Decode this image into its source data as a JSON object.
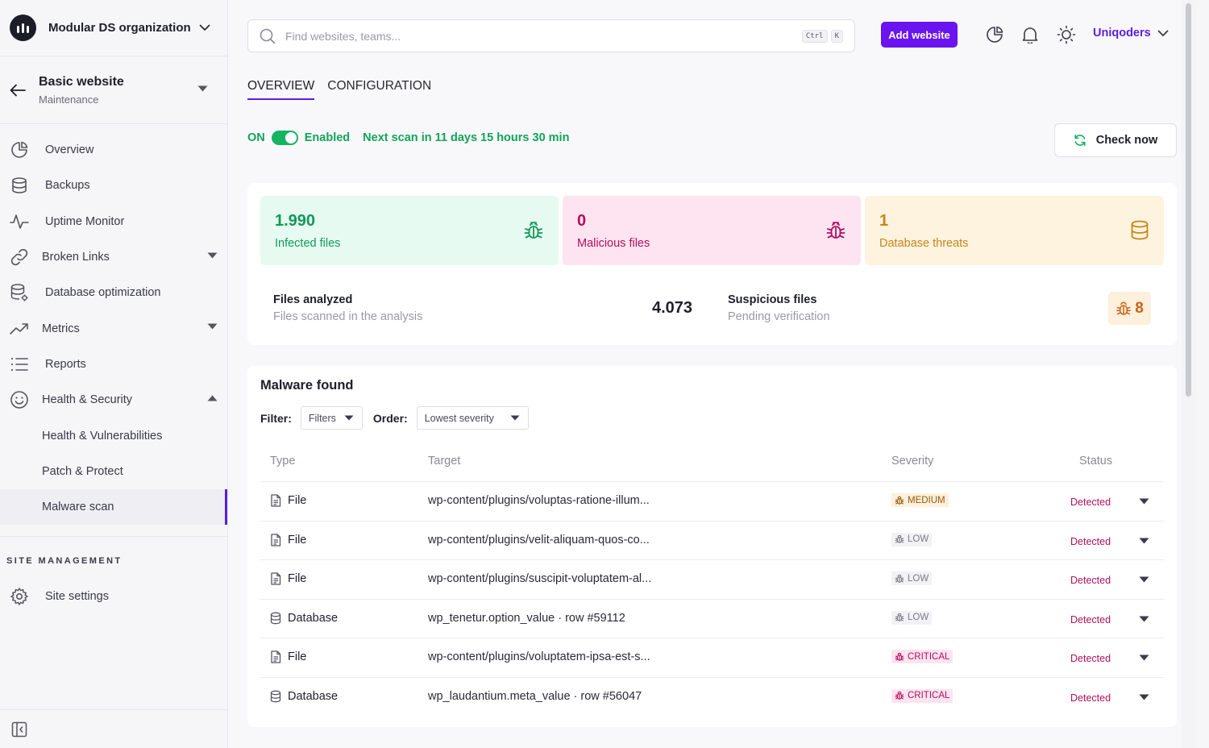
{
  "org": {
    "name": "Modular DS organization"
  },
  "site": {
    "title": "Basic website",
    "subtitle": "Maintenance"
  },
  "nav": {
    "overview": "Overview",
    "backups": "Backups",
    "uptime": "Uptime Monitor",
    "broken_links": "Broken Links",
    "db_opt": "Database optimization",
    "metrics": "Metrics",
    "reports": "Reports",
    "health_security": "Health & Security",
    "health_vuln": "Health & Vulnerabilities",
    "patch": "Patch & Protect",
    "malware": "Malware scan"
  },
  "site_management": {
    "title": "SITE MANAGEMENT",
    "settings": "Site settings"
  },
  "search": {
    "placeholder": "Find websites, teams...",
    "kbd1": "Ctrl",
    "kbd2": "K"
  },
  "header": {
    "add_website": "Add website",
    "user": "Uniqoders"
  },
  "tabs": {
    "overview": "OVERVIEW",
    "configuration": "CONFIGURATION"
  },
  "status": {
    "on": "ON",
    "enabled": "Enabled",
    "next_scan": "Next scan in 11 days 15 hours 30 min",
    "check_now": "Check now"
  },
  "stats": {
    "infected": {
      "value": "1.990",
      "label": "Infected files"
    },
    "malicious": {
      "value": "0",
      "label": "Malicious files"
    },
    "db_threats": {
      "value": "1",
      "label": "Database threats"
    },
    "analyzed": {
      "title": "Files analyzed",
      "subtitle": "Files scanned in the analysis",
      "value": "4.073"
    },
    "suspicious": {
      "title": "Suspicious files",
      "subtitle": "Pending verification",
      "value": "8"
    }
  },
  "malware": {
    "title": "Malware found",
    "filter_label": "Filter:",
    "filter_value": "Filters",
    "order_label": "Order:",
    "order_value": "Lowest severity",
    "columns": {
      "type": "Type",
      "target": "Target",
      "severity": "Severity",
      "status": "Status"
    },
    "rows": [
      {
        "type": "File",
        "target": "wp-content/plugins/voluptas-ratione-illum...",
        "severity": "MEDIUM",
        "status": "Detected"
      },
      {
        "type": "File",
        "target": "wp-content/plugins/velit-aliquam-quos-co...",
        "severity": "LOW",
        "status": "Detected"
      },
      {
        "type": "File",
        "target": "wp-content/plugins/suscipit-voluptatem-al...",
        "severity": "LOW",
        "status": "Detected"
      },
      {
        "type": "Database",
        "target": "wp_tenetur.option_value · row #59112",
        "severity": "LOW",
        "status": "Detected"
      },
      {
        "type": "File",
        "target": "wp-content/plugins/voluptatem-ipsa-est-s...",
        "severity": "CRITICAL",
        "status": "Detected"
      },
      {
        "type": "Database",
        "target": "wp_laudantium.meta_value · row #56047",
        "severity": "CRITICAL",
        "status": "Detected"
      }
    ]
  },
  "colors": {
    "accent": "#6a14f0",
    "green": "#12a35a",
    "pink": "#b0105e",
    "amber": "#c7861a"
  }
}
